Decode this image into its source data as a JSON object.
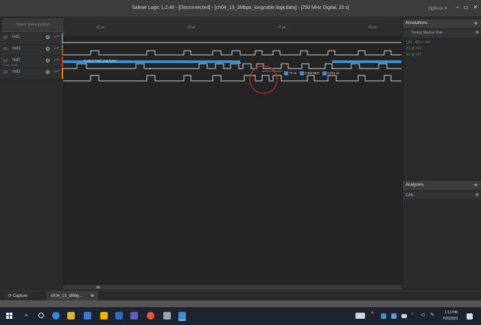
{
  "window": {
    "title": "Saleae Logic 1.2.40 - [Disconnected] - [ch04_13_3Mbps_longcable.logicdata] - [250 MHz Digital, 20 s]",
    "options_label": "Options ▾",
    "minimize": "–",
    "restore": "▭",
    "close": "✕"
  },
  "left": {
    "start_button": "Start Simulation",
    "channels": [
      {
        "num": "00",
        "name": "txd1",
        "sub": "",
        "color": "#5d86a8"
      },
      {
        "num": "01",
        "name": "rxd1",
        "sub": "",
        "color": "#8a6b3a"
      },
      {
        "num": "02",
        "name": "txd2",
        "sub": "CAN - CAN",
        "color": "#c43b2e"
      },
      {
        "num": "03",
        "name": "rxd2",
        "sub": "",
        "color": "#e38a1f"
      }
    ],
    "gear_glyph": "⚙",
    "edge_glyph": "⌐+"
  },
  "ruler": {
    "ticks": [
      "+2 µs",
      "+3 µs",
      "+4 µs",
      "+5 µs"
    ]
  },
  "waveform": {
    "can_label": "Control Field: 2nd bytes",
    "measurement": {
      "width": "72 ns",
      "freq": "4.464 MHz",
      "period": "0.224 us"
    }
  },
  "annotations_panel": {
    "title": "Annotations",
    "plus": "+",
    "marker_title": "Timing Marker Pair",
    "line1": "| A1 - A2 | = ###",
    "line2": "A1 @ ###",
    "line3": "A2 @ ###"
  },
  "analyzers_panel": {
    "title": "Analyzers",
    "plus": "+",
    "items": [
      {
        "label": "CAN"
      }
    ]
  },
  "tabs": {
    "capture": "Capture",
    "file": "ch04_13_3Mbp...",
    "file_close": "⊗"
  },
  "taskbar": {
    "time": "1:13 PM",
    "date": "7/25/2022"
  },
  "colors": {
    "accent_blue": "#3e8ed0",
    "highlight_circle": "#c0302a"
  }
}
